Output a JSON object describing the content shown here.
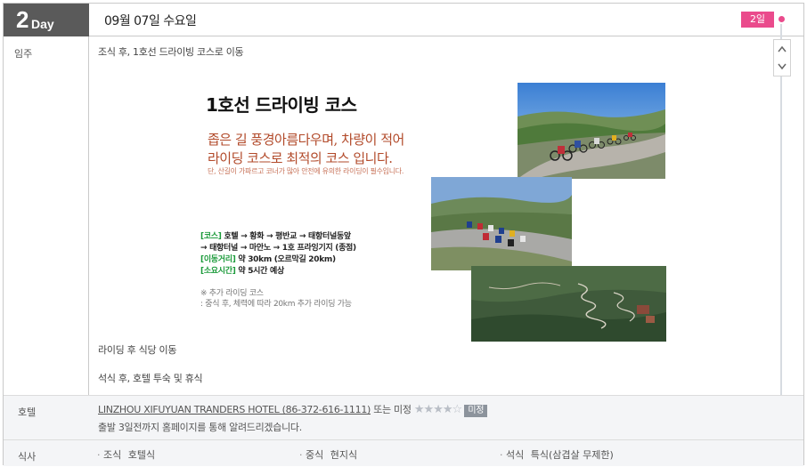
{
  "header": {
    "day_number": "2",
    "day_word": "Day",
    "date": "09월 07일 수요일",
    "day_badge": "2일"
  },
  "location_label": "임주",
  "schedule": {
    "line1": "조식 후, 1호선 드라이빙 코스로 이동",
    "line2": "라이딩 후 식당 이동",
    "line3": "석식 후, 호텔 투숙 및 휴식"
  },
  "course": {
    "title": "1호선 드라이빙 코스",
    "subtitle1": "좁은 길 풍경아름다우며,  차량이 적어",
    "subtitle2": "라이딩 코스로 최적의 코스 입니다.",
    "note": "단, 산길이 가파르고 코너가 많아 안전에 유의한 라이딩이 필수입니다.",
    "course_tag": "[코스]",
    "course_text1": "호텔 → 황화 → 평반교 → 태항터널동앞",
    "course_text2": "→ 태항터널 → 마안노 → 1호 프라잉기지 (종점)",
    "distance_tag": "[이동거리]",
    "distance_text": "약 30km (오르막길 20km)",
    "time_tag": "[소요시간]",
    "time_text": "약 5시간 예상",
    "extra_title": "※ 추가 라이딩 코스",
    "extra_text": ": 중식 후, 체력에 따라 20km 추가 라이딩 가능"
  },
  "hotel": {
    "label": "호텔",
    "name": "LINZHOU XIFUYUAN TRANDERS HOTEL (86-372-616-1111)",
    "suffix": "또는 미정",
    "stars": "★★★★☆",
    "status": "미정",
    "notice": "출발 3일전까지 홈페이지를 통해 알려드리겠습니다."
  },
  "meals": {
    "label": "식사",
    "items": [
      {
        "bullet": "·",
        "type": "조식",
        "value": "호텔식"
      },
      {
        "bullet": "·",
        "type": "중식",
        "value": "현지식"
      },
      {
        "bullet": "·",
        "type": "석식",
        "value": "특식(삼겹살 무제한)"
      }
    ]
  },
  "colors": {
    "accent_pink": "#ea4b8c",
    "day_box": "#5a5a5a",
    "course_subtitle": "#b24a2a",
    "course_tag_green": "#1b9a3a"
  }
}
